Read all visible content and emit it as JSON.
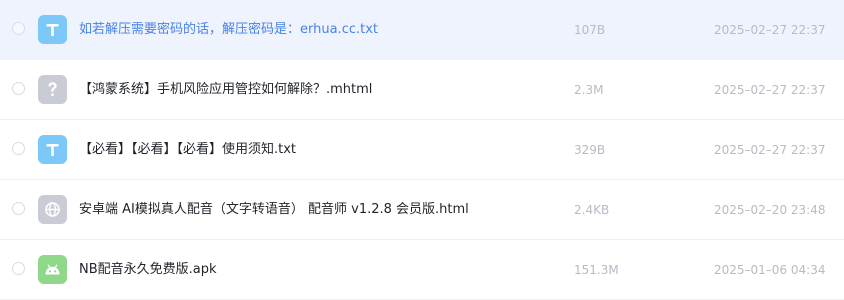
{
  "files": [
    {
      "name": "如若解压需要密码的话，解压密码是：erhua.cc.txt",
      "size": "107B",
      "date": "2025–02–27 22:37",
      "icon": "text-file-icon",
      "icon_color": "#7cc8f8",
      "highlighted": true
    },
    {
      "name": "【鸿蒙系统】手机风险应用管控如何解除？.mhtml",
      "size": "2.3M",
      "date": "2025–02–27 22:37",
      "icon": "unknown-file-icon",
      "icon_color": "#c9ccd4",
      "highlighted": false
    },
    {
      "name": "【必看】【必看】【必看】使用须知.txt",
      "size": "329B",
      "date": "2025–02–27 22:37",
      "icon": "text-file-icon",
      "icon_color": "#7cc8f8",
      "highlighted": false
    },
    {
      "name": "安卓端 AI模拟真人配音（文字转语音） 配音师 v1.2.8 会员版.html",
      "size": "2.4KB",
      "date": "2025–02–20 23:48",
      "icon": "web-file-icon",
      "icon_color": "#c9ccd4",
      "highlighted": false
    },
    {
      "name": "NB配音永久免费版.apk",
      "size": "151.3M",
      "date": "2025–01–06 04:34",
      "icon": "android-apk-icon",
      "icon_color": "#8fd88a",
      "highlighted": false
    }
  ]
}
